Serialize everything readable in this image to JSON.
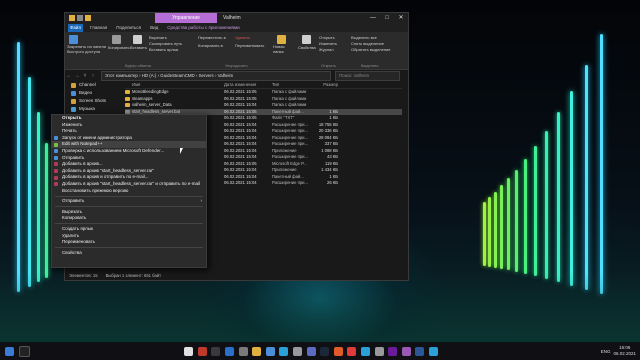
{
  "window": {
    "title": "Valheim",
    "context_tab": "Управление",
    "ribbon_tabs": [
      "Файл",
      "Главная",
      "Поделиться",
      "Вид",
      "Средства работы с приложениями"
    ],
    "ribbon": {
      "pin": "Закрепить на панели быстрого доступа",
      "copy": "Копировать",
      "paste": "Вставить",
      "cut": "Вырезать",
      "copy_path": "Скопировать путь",
      "paste_shortcut": "Вставить ярлык",
      "move_to": "Переместить в",
      "copy_to": "Копировать в",
      "delete": "Удалить",
      "rename": "Переименовать",
      "new_folder": "Новая папка",
      "properties": "Свойства",
      "open": "Открыть",
      "edit": "Изменить",
      "journal": "Журнал",
      "select_all": "Выделить все",
      "select_none": "Снять выделение",
      "invert": "Обратить выделение",
      "group_clipboard": "Буфер обмена",
      "group_organize": "Упорядочить",
      "group_open": "Открыть",
      "group_select": "Выделить"
    },
    "address": {
      "crumbs": [
        "Этот компьютер",
        "HD (A:)",
        "GuideSteamCMD",
        "Servers",
        "Valheim"
      ],
      "search_placeholder": "Поиск: Valheim"
    },
    "nav_items": [
      {
        "label": "Channel",
        "color": "#d6a03c"
      },
      {
        "label": "Видео",
        "color": "#4a8fd8"
      },
      {
        "label": "Screen Shots",
        "color": "#d6a03c"
      },
      {
        "label": "Музыка",
        "color": "#4a9fd8"
      }
    ],
    "columns": {
      "name": "Имя",
      "date": "Дата изменения",
      "type": "Тип",
      "size": "Размер"
    },
    "files": [
      {
        "name": "MonoBleedingEdge",
        "date": "06.02.2021 15:05",
        "type": "Папка с файлами",
        "size": "",
        "color": "#e0b040",
        "selected": false
      },
      {
        "name": "steamapps",
        "date": "06.02.2021 15:05",
        "type": "Папка с файлами",
        "size": "",
        "color": "#e0b040",
        "selected": false
      },
      {
        "name": "valheim_server_Data",
        "date": "06.02.2021 15:04",
        "type": "Папка с файлами",
        "size": "",
        "color": "#e0b040",
        "selected": false
      },
      {
        "name": "start_headless_server.bat",
        "date": "06.02.2021 15:05",
        "type": "Пакетный фай...",
        "size": "1 КБ",
        "color": "#8c8c8c",
        "selected": true
      },
      {
        "name": "steam_appid.txt",
        "date": "06.02.2021 15:05",
        "type": "Файл \"TXT\"",
        "size": "1 КБ",
        "color": "#cfcfcf",
        "selected": false
      },
      {
        "name": "steamclient64.dll",
        "date": "06.02.2021 15:04",
        "type": "Расширение при...",
        "size": "18 755 КБ",
        "color": "#9a9a9a",
        "selected": false
      },
      {
        "name": "tier0_s64.dll",
        "date": "06.02.2021 15:04",
        "type": "Расширение при...",
        "size": "20 336 КБ",
        "color": "#9a9a9a",
        "selected": false
      },
      {
        "name": "UnityPlayer.dll",
        "date": "06.02.2021 15:04",
        "type": "Расширение при...",
        "size": "28 084 КБ",
        "color": "#9a9a9a",
        "selected": false
      },
      {
        "name": "vstdlib_s64.dll",
        "date": "06.02.2021 15:04",
        "type": "Расширение при...",
        "size": "337 КБ",
        "color": "#9a9a9a",
        "selected": false
      },
      {
        "name": "valheim_server.exe",
        "date": "06.02.2021 15:04",
        "type": "Приложение",
        "size": "1 088 КБ",
        "color": "#4a8fd8",
        "selected": false
      },
      {
        "name": "WinPixEventRuntime.dll",
        "date": "06.02.2021 15:04",
        "type": "Расширение при...",
        "size": "43 КБ",
        "color": "#9a9a9a",
        "selected": false
      },
      {
        "name": "UnityCrashHandler64.exe",
        "date": "06.02.2021 15:05",
        "type": "Microsoft Edge P...",
        "size": "119 КБ",
        "color": "#4a8fd8",
        "selected": false
      },
      {
        "name": "steam_api64.dll",
        "date": "06.02.2021 15:04",
        "type": "Приложение",
        "size": "1 434 КБ",
        "color": "#4a8fd8",
        "selected": false
      },
      {
        "name": "start_server.bat",
        "date": "06.02.2021 15:04",
        "type": "Пакетный фай...",
        "size": "1 КБ",
        "color": "#8c8c8c",
        "selected": false
      },
      {
        "name": "server_data.txt",
        "date": "06.02.2021 15:04",
        "type": "Расширение при...",
        "size": "26 КБ",
        "color": "#9a9a9a",
        "selected": false
      }
    ],
    "status": {
      "count": "Элементов: 15",
      "selected": "Выбран 1 элемент: 651 байт"
    }
  },
  "context_menu": {
    "items": [
      {
        "label": "Открыть",
        "bold": true,
        "icon": "",
        "sep_after": false,
        "arrow": false
      },
      {
        "label": "Изменить",
        "bold": false,
        "icon": "",
        "sep_after": false,
        "arrow": false
      },
      {
        "label": "Печать",
        "bold": false,
        "icon": "",
        "sep_after": false,
        "arrow": false
      },
      {
        "label": "Запуск от имени администратора",
        "bold": false,
        "icon": "#4a8fd8",
        "sep_after": false,
        "arrow": false
      },
      {
        "label": "Edit with Notepad++",
        "bold": false,
        "icon": "#7bc043",
        "sep_after": false,
        "arrow": false,
        "hover": true
      },
      {
        "label": "Проверка с использованием Microsoft Defender...",
        "bold": false,
        "icon": "#4a8fd8",
        "sep_after": false,
        "arrow": false
      },
      {
        "label": "Отправить",
        "bold": false,
        "icon": "#4a8fd8",
        "sep_after": false,
        "arrow": false
      },
      {
        "label": "Добавить в архив...",
        "bold": false,
        "icon": "#b03a5a",
        "sep_after": false,
        "arrow": false
      },
      {
        "label": "Добавить в архив \"start_headless_server.rar\"",
        "bold": false,
        "icon": "#b03a5a",
        "sep_after": false,
        "arrow": false
      },
      {
        "label": "Добавить в архив и отправить по e-mail...",
        "bold": false,
        "icon": "#b03a5a",
        "sep_after": false,
        "arrow": false
      },
      {
        "label": "Добавить в архив \"start_headless_server.rar\" и отправить по e-mail",
        "bold": false,
        "icon": "#b03a5a",
        "sep_after": false,
        "arrow": false
      },
      {
        "label": "Восстановить прежнюю версию",
        "bold": false,
        "icon": "",
        "sep_after": true,
        "arrow": false
      },
      {
        "label": "Отправить",
        "bold": false,
        "icon": "",
        "sep_after": true,
        "arrow": true
      },
      {
        "label": "Вырезать",
        "bold": false,
        "icon": "",
        "sep_after": false,
        "arrow": false
      },
      {
        "label": "Копировать",
        "bold": false,
        "icon": "",
        "sep_after": true,
        "arrow": false
      },
      {
        "label": "Создать ярлык",
        "bold": false,
        "icon": "",
        "sep_after": false,
        "arrow": false
      },
      {
        "label": "Удалить",
        "bold": false,
        "icon": "",
        "sep_after": false,
        "arrow": false
      },
      {
        "label": "Переименовать",
        "bold": false,
        "icon": "",
        "sep_after": true,
        "arrow": false
      },
      {
        "label": "Свойства",
        "bold": false,
        "icon": "",
        "sep_after": false,
        "arrow": false
      }
    ]
  },
  "taskbar": {
    "pinned": [
      "#e0e0e0",
      "#c0392b",
      "#3a3a3a",
      "#2a6fc9",
      "#7a7a7a",
      "#e0b040",
      "#4a8fd8",
      "#2aa0d8",
      "#9a9a9a",
      "#5c6bc0",
      "#1b2838",
      "#e05a2a",
      "#e03a3a",
      "#2a9fd8",
      "#9a9a9a",
      "#6a1b9a",
      "#9b59b6",
      "#2b5797",
      "#2a9fd8"
    ],
    "lang": "ENG",
    "time": "15:06",
    "date": "06.02.2021"
  }
}
